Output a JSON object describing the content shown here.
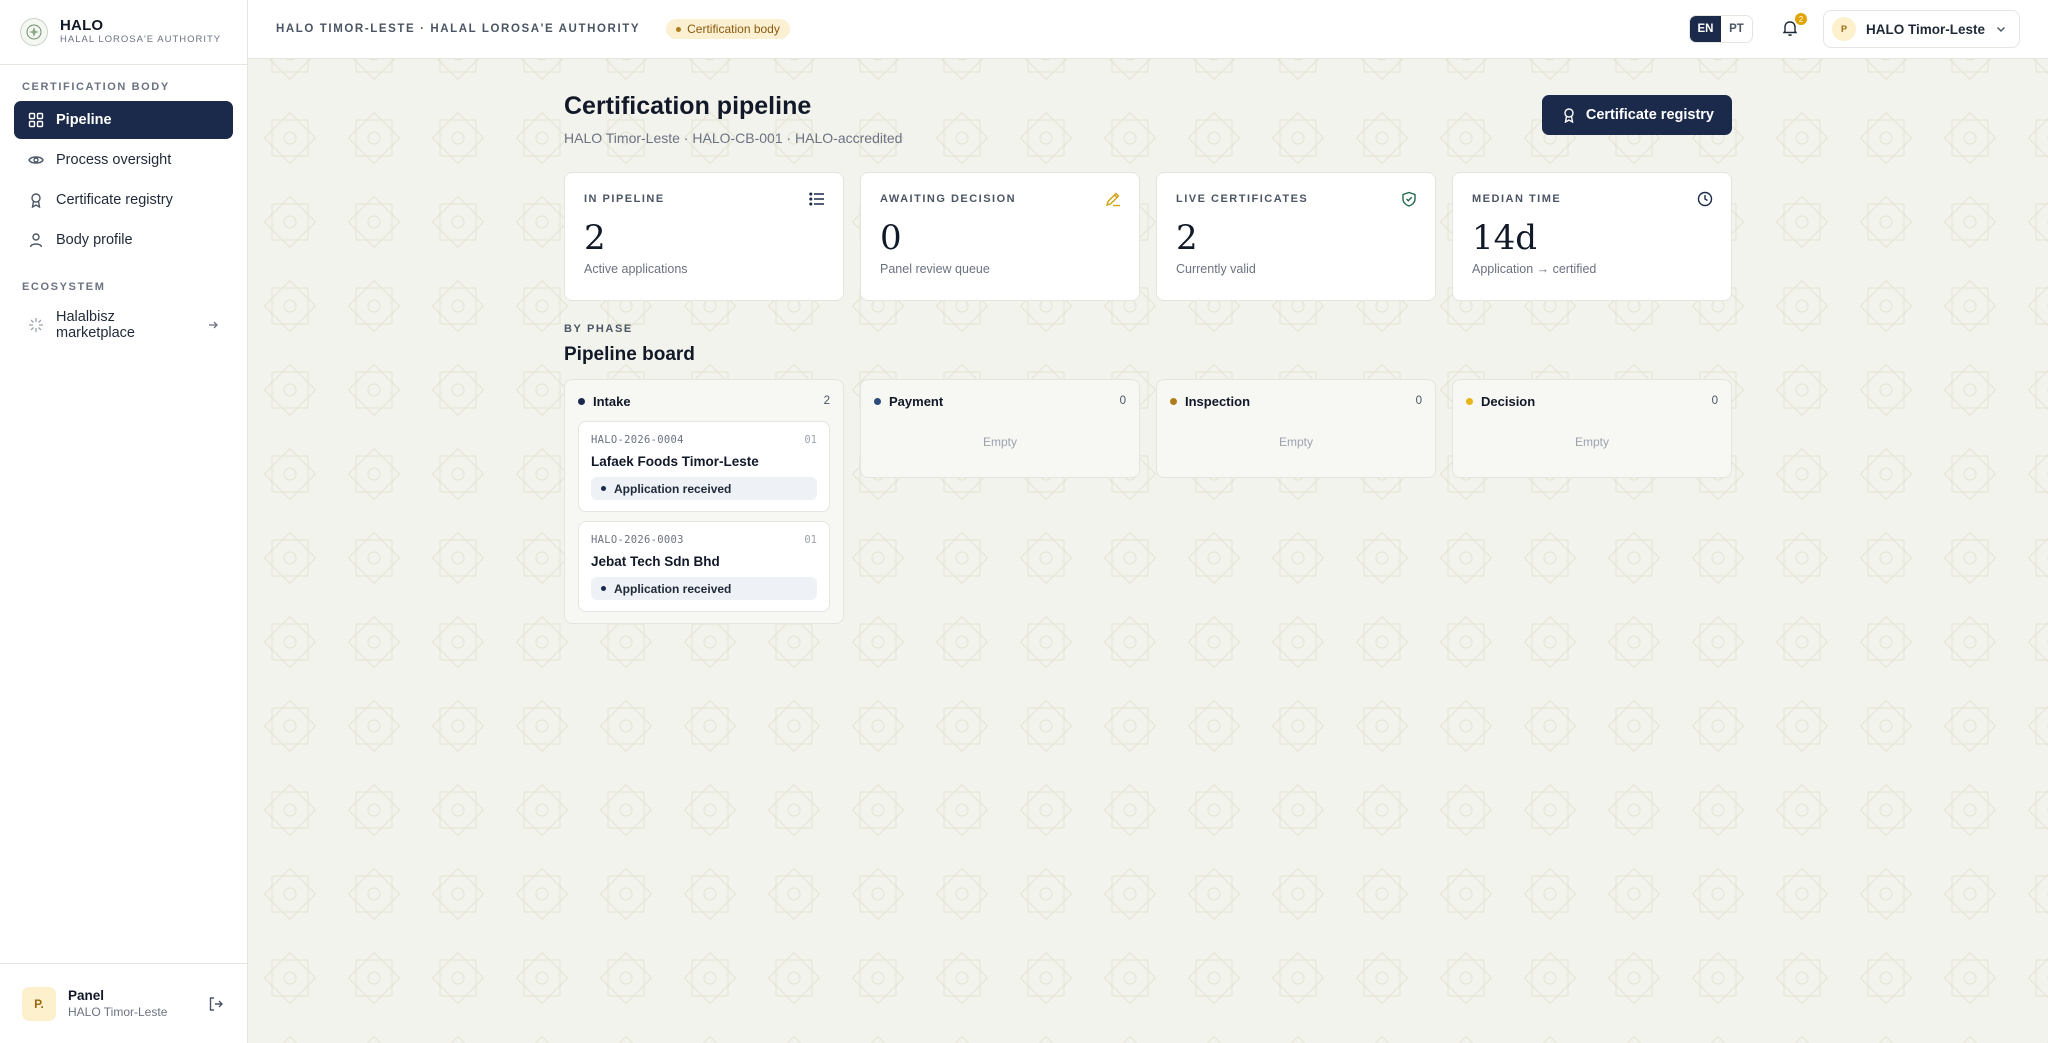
{
  "brand": {
    "title": "HALO",
    "subtitle": "HALAL LOROSA'E AUTHORITY"
  },
  "sidebar": {
    "sections": [
      {
        "label": "CERTIFICATION BODY"
      },
      {
        "label": "ECOSYSTEM"
      }
    ],
    "items": [
      {
        "label": "Pipeline",
        "icon": "grid-icon",
        "active": true
      },
      {
        "label": "Process oversight",
        "icon": "eye-icon"
      },
      {
        "label": "Certificate registry",
        "icon": "award-icon"
      },
      {
        "label": "Body profile",
        "icon": "user-icon"
      }
    ],
    "ecosystem_items": [
      {
        "label_line1": "Halalbisz",
        "label_line2": "marketplace",
        "icon": "sparkle-icon"
      }
    ],
    "footer": {
      "avatar": "P.",
      "name": "Panel",
      "sub": "HALO Timor-Leste"
    }
  },
  "topbar": {
    "crumb": "HALO TIMOR-LESTE · HALAL LOROSA'E AUTHORITY",
    "tag": "Certification body",
    "languages": [
      "EN",
      "PT"
    ],
    "active_language": "EN",
    "notification_count": "2",
    "account": {
      "avatar": "P",
      "name": "HALO Timor-Leste"
    }
  },
  "page": {
    "title": "Certification pipeline",
    "subtitle": "HALO Timor-Leste · HALO-CB-001 · HALO-accredited",
    "primary_button": "Certificate registry"
  },
  "stats": [
    {
      "label": "IN PIPELINE",
      "value": "2",
      "caption": "Active applications",
      "icon": "list-icon"
    },
    {
      "label": "AWAITING DECISION",
      "value": "0",
      "caption": "Panel review queue",
      "icon": "pencil-icon"
    },
    {
      "label": "LIVE CERTIFICATES",
      "value": "2",
      "caption": "Currently valid",
      "icon": "shield-check-icon"
    },
    {
      "label": "MEDIAN TIME",
      "value": "14d",
      "caption": "Application → certified",
      "icon": "clock-icon"
    }
  ],
  "board": {
    "phase_label": "BY PHASE",
    "title": "Pipeline board",
    "columns": [
      {
        "name": "Intake",
        "count": "2",
        "dot_color": "#1b2a4a",
        "cards": [
          {
            "id": "HALO-2026-0004",
            "num": "01",
            "name": "Lafaek Foods Timor-Leste",
            "status": "Application received"
          },
          {
            "id": "HALO-2026-0003",
            "num": "01",
            "name": "Jebat Tech Sdn Bhd",
            "status": "Application received"
          }
        ]
      },
      {
        "name": "Payment",
        "count": "0",
        "dot_color": "#2a4a7a",
        "empty": "Empty"
      },
      {
        "name": "Inspection",
        "count": "0",
        "dot_color": "#b07d1b",
        "empty": "Empty"
      },
      {
        "name": "Decision",
        "count": "0",
        "dot_color": "#e8b417",
        "empty": "Empty"
      }
    ]
  },
  "colors": {
    "navy": "#1b2a4a",
    "gold": "#e2a400",
    "background": "#f3f3ee"
  }
}
